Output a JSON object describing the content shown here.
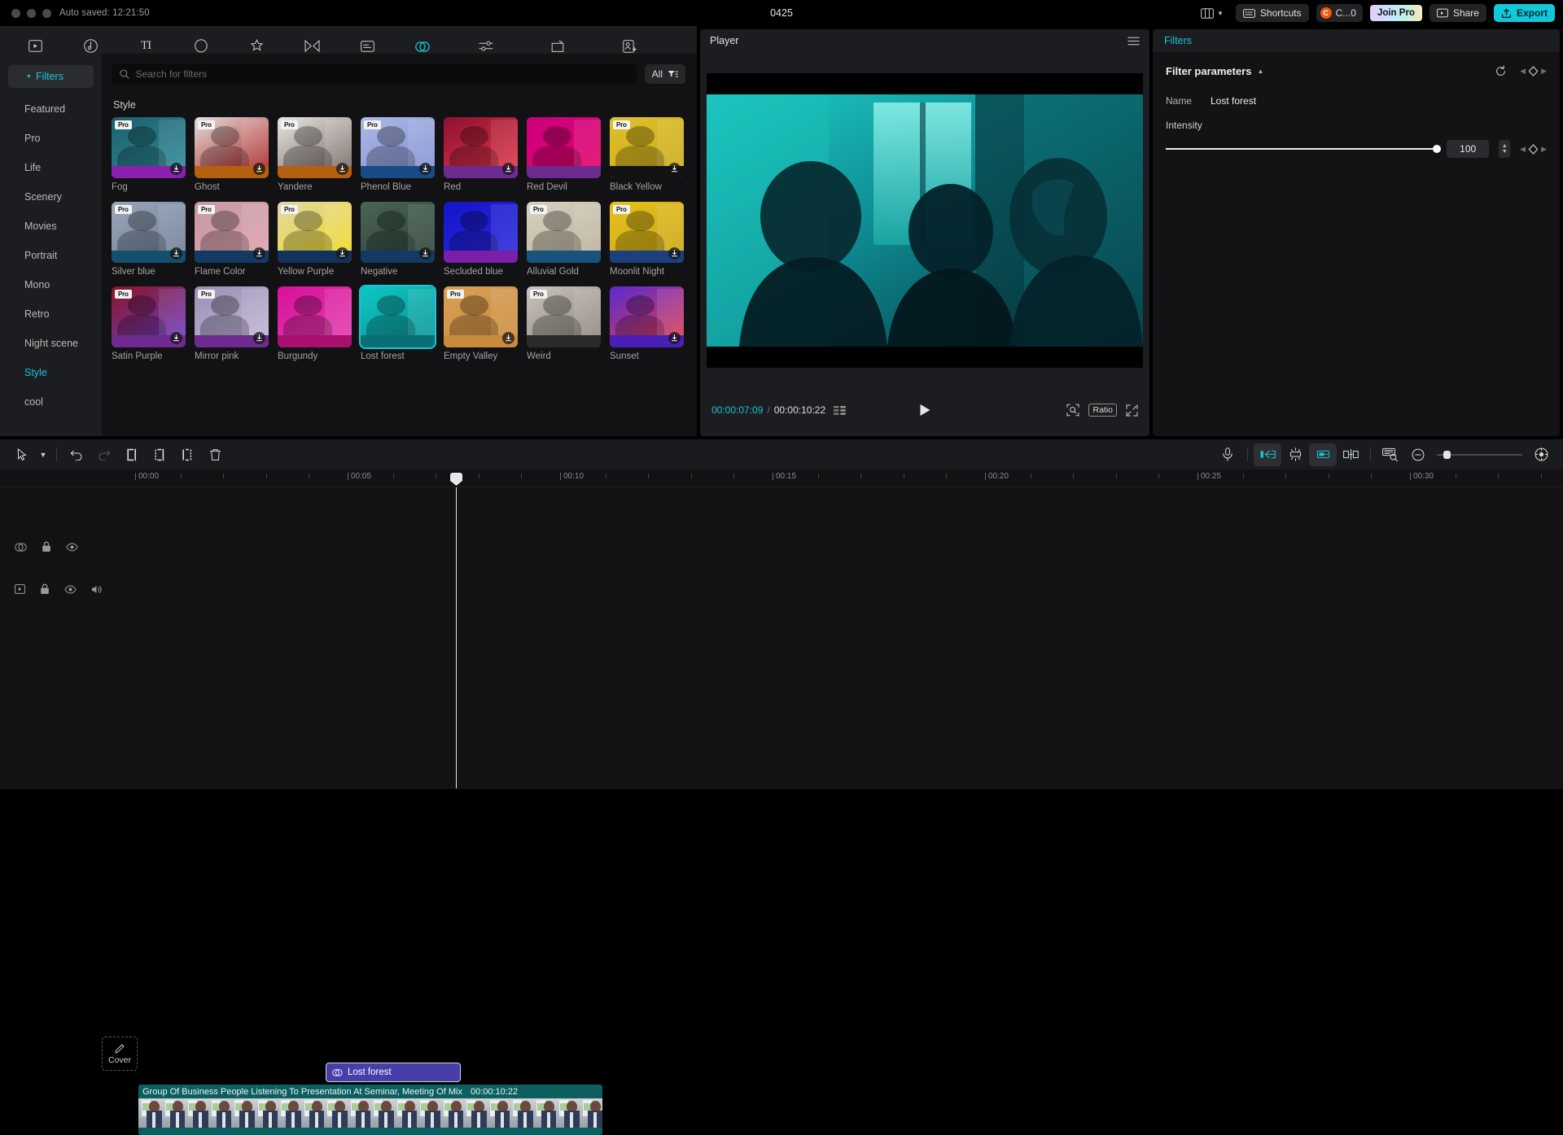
{
  "titlebar": {
    "autosave": "Auto saved: 12:21:50",
    "project_title": "0425",
    "layout_icon": "layout-icon",
    "shortcuts_label": "Shortcuts",
    "credits_label": "C...0",
    "credits_icon": "credit-coin-icon",
    "join_pro_label": "Join Pro",
    "share_label": "Share",
    "export_label": "Export"
  },
  "modules": [
    {
      "label": "Import",
      "icon": "import-icon",
      "active": false
    },
    {
      "label": "Audio",
      "icon": "audio-icon",
      "active": false
    },
    {
      "label": "Text",
      "icon": "text-icon",
      "active": false
    },
    {
      "label": "Stickers",
      "icon": "stickers-icon",
      "active": false
    },
    {
      "label": "Effects",
      "icon": "effects-icon",
      "active": false
    },
    {
      "label": "Transitions",
      "icon": "transitions-icon",
      "active": false
    },
    {
      "label": "Captions",
      "icon": "captions-icon",
      "active": false
    },
    {
      "label": "Filters",
      "icon": "filters-icon",
      "active": true
    },
    {
      "label": "Adjustment",
      "icon": "adjustment-icon",
      "active": false
    },
    {
      "label": "Templates",
      "icon": "templates-icon",
      "active": false
    },
    {
      "label": "AI Characters",
      "icon": "ai-characters-icon",
      "active": false
    }
  ],
  "library": {
    "sidebar": {
      "header": "Filters",
      "items": [
        {
          "label": "Featured",
          "selected": false
        },
        {
          "label": "Pro",
          "selected": false
        },
        {
          "label": "Life",
          "selected": false
        },
        {
          "label": "Scenery",
          "selected": false
        },
        {
          "label": "Movies",
          "selected": false
        },
        {
          "label": "Portrait",
          "selected": false
        },
        {
          "label": "Mono",
          "selected": false
        },
        {
          "label": "Retro",
          "selected": false
        },
        {
          "label": "Night scene",
          "selected": false
        },
        {
          "label": "Style",
          "selected": true
        },
        {
          "label": "cool",
          "selected": false
        }
      ]
    },
    "search": {
      "placeholder": "Search for filters",
      "value": "",
      "icon": "search-icon"
    },
    "filter_button": {
      "label": "All",
      "icon": "filter-funnel-icon"
    },
    "section_title": "Style",
    "items": [
      {
        "label": "Fog",
        "pro": true,
        "download": true,
        "selected": false,
        "c1": "#1d5f6b",
        "c2": "#2e8e9c",
        "strip": "#8a1fb0"
      },
      {
        "label": "Ghost",
        "pro": true,
        "download": true,
        "selected": false,
        "c1": "#e3e0dd",
        "c2": "#a81414",
        "strip": "#b5600f"
      },
      {
        "label": "Yandere",
        "pro": true,
        "download": true,
        "selected": false,
        "c1": "#e9e7e4",
        "c2": "#6e5f5a",
        "strip": "#b5600f"
      },
      {
        "label": "Phenol Blue",
        "pro": true,
        "download": true,
        "selected": false,
        "c1": "#aeb8e6",
        "c2": "#7d8fd0",
        "strip": "#1b4b86"
      },
      {
        "label": "Red",
        "pro": false,
        "download": true,
        "selected": false,
        "c1": "#8e1130",
        "c2": "#e8394c",
        "strip": "#6d2a8f"
      },
      {
        "label": "Red Devil",
        "pro": false,
        "download": false,
        "selected": false,
        "c1": "#c9007e",
        "c2": "#e8006a",
        "strip": "#6d2a8f"
      },
      {
        "label": "Black Yellow",
        "pro": true,
        "download": true,
        "selected": false,
        "c1": "#e0c12a",
        "c2": "#c9a915",
        "strip": "#121212"
      },
      {
        "label": "Silver blue",
        "pro": true,
        "download": true,
        "selected": false,
        "c1": "#9aa7bb",
        "c2": "#6c7b92",
        "strip": "#14506e"
      },
      {
        "label": "Flame Color",
        "pro": true,
        "download": true,
        "selected": false,
        "c1": "#c49aa6",
        "c2": "#e0a2ac",
        "strip": "#123a63"
      },
      {
        "label": "Yellow Purple",
        "pro": true,
        "download": true,
        "selected": false,
        "c1": "#e2d8a8",
        "c2": "#efd915",
        "strip": "#12325e"
      },
      {
        "label": "Negative",
        "pro": false,
        "download": true,
        "selected": false,
        "c1": "#4a6456",
        "c2": "#2d4237",
        "strip": "#123a63"
      },
      {
        "label": "Secluded blue",
        "pro": false,
        "download": false,
        "selected": false,
        "c1": "#1414c8",
        "c2": "#2a2ae0",
        "strip": "#7a1fa8"
      },
      {
        "label": "Alluvial Gold",
        "pro": true,
        "download": false,
        "selected": false,
        "c1": "#d8d2c0",
        "c2": "#b8ae98",
        "strip": "#17537a"
      },
      {
        "label": "Moonlit Night",
        "pro": true,
        "download": true,
        "selected": false,
        "c1": "#e7c21f",
        "c2": "#c9a412",
        "strip": "#1c3f7d"
      },
      {
        "label": "Satin Purple",
        "pro": true,
        "download": true,
        "selected": false,
        "c1": "#8a1525",
        "c2": "#6c3fd0",
        "strip": "#6d2a8f"
      },
      {
        "label": "Mirror pink",
        "pro": true,
        "download": true,
        "selected": false,
        "c1": "#9a8fb5",
        "c2": "#c6b9d8",
        "strip": "#6d2a8f"
      },
      {
        "label": "Burgundy",
        "pro": false,
        "download": false,
        "selected": false,
        "c1": "#d6119a",
        "c2": "#e83fb0",
        "strip": "#a8106e"
      },
      {
        "label": "Lost forest",
        "pro": false,
        "download": false,
        "selected": true,
        "c1": "#0fc7c2",
        "c2": "#0a8f94",
        "strip": "#0a6e72"
      },
      {
        "label": "Empty Valley",
        "pro": true,
        "download": true,
        "selected": false,
        "c1": "#d9a055",
        "c2": "#c98a3c",
        "strip": "#c98a3c"
      },
      {
        "label": "Weird",
        "pro": true,
        "download": false,
        "selected": false,
        "c1": "#c9c4bd",
        "c2": "#8a8178",
        "strip": "#2a2a2a"
      },
      {
        "label": "Sunset",
        "pro": false,
        "download": true,
        "selected": false,
        "c1": "#5a2ad0",
        "c2": "#e8404a",
        "strip": "#4a1fb8"
      }
    ]
  },
  "player": {
    "title": "Player",
    "menu_icon": "hamburger-icon",
    "current_time": "00:00:07:09",
    "separator": "/",
    "total_time": "00:00:10:22",
    "frames_icon": "frames-icon",
    "play_icon": "play-icon",
    "zoom_icon": "zoom-fit-icon",
    "ratio_label": "Ratio",
    "fullscreen_icon": "fullscreen-icon"
  },
  "properties": {
    "panel_title": "Filters",
    "section_title": "Filter parameters",
    "collapse_icon": "chevron-up-icon",
    "reset_icon": "reset-icon",
    "keyframe_icon": "keyframe-diamond-icon",
    "name_label": "Name",
    "name_value": "Lost forest",
    "intensity_label": "Intensity",
    "intensity_value": "100",
    "intensity_percent": 100
  },
  "timeline": {
    "toolbar_left": [
      {
        "name": "pointer-tool",
        "icon": "cursor-icon"
      },
      {
        "name": "tool-dropdown",
        "icon": "chevron-down-icon"
      },
      {
        "name": "undo-button",
        "icon": "undo-icon"
      },
      {
        "name": "redo-button",
        "icon": "redo-icon"
      },
      {
        "name": "split-button",
        "icon": "split-icon"
      },
      {
        "name": "trim-start-button",
        "icon": "trim-start-icon"
      },
      {
        "name": "trim-end-button",
        "icon": "trim-end-icon"
      },
      {
        "name": "delete-button",
        "icon": "trash-icon"
      }
    ],
    "toolbar_right": [
      {
        "name": "record-voiceover-button",
        "icon": "microphone-icon"
      },
      {
        "name": "markers-in-button",
        "icon": "marker-in-icon"
      },
      {
        "name": "auto-sync-button",
        "icon": "magnet-icon"
      },
      {
        "name": "markers-out-button",
        "icon": "marker-out-icon"
      },
      {
        "name": "crop-button",
        "icon": "crop-icon"
      },
      {
        "name": "render-preview-button",
        "icon": "render-preview-icon"
      },
      {
        "name": "zoom-out-button",
        "icon": "zoom-out-icon"
      },
      {
        "name": "zoom-fit-button",
        "icon": "zoom-target-icon"
      }
    ],
    "ruler_labels": [
      "00:00",
      "00:05",
      "00:10",
      "00:15",
      "00:20",
      "00:25",
      "00:30"
    ],
    "cover_label": "Cover",
    "cover_icon": "pencil-icon",
    "filter_clip": {
      "label": "Lost forest",
      "icon": "filters-icon"
    },
    "video_clip": {
      "title": "Group Of Business People Listening To Presentation At Seminar, Meeting Of Mix",
      "duration": "00:00:10:22"
    },
    "fx_track_controls": [
      {
        "name": "filter-track-icon",
        "icon": "filters-icon"
      },
      {
        "name": "lock-track-button",
        "icon": "lock-icon"
      },
      {
        "name": "hide-track-button",
        "icon": "eye-icon"
      }
    ],
    "video_track_controls": [
      {
        "name": "video-track-icon",
        "icon": "video-icon"
      },
      {
        "name": "lock-track-button",
        "icon": "lock-icon"
      },
      {
        "name": "hide-track-button",
        "icon": "eye-icon"
      },
      {
        "name": "mute-track-button",
        "icon": "speaker-icon"
      }
    ]
  },
  "colors": {
    "accent": "#19c4d6",
    "export": "#12c8d8",
    "clip_fx": "#473ea8",
    "clip_video": "#0d5f5f"
  }
}
